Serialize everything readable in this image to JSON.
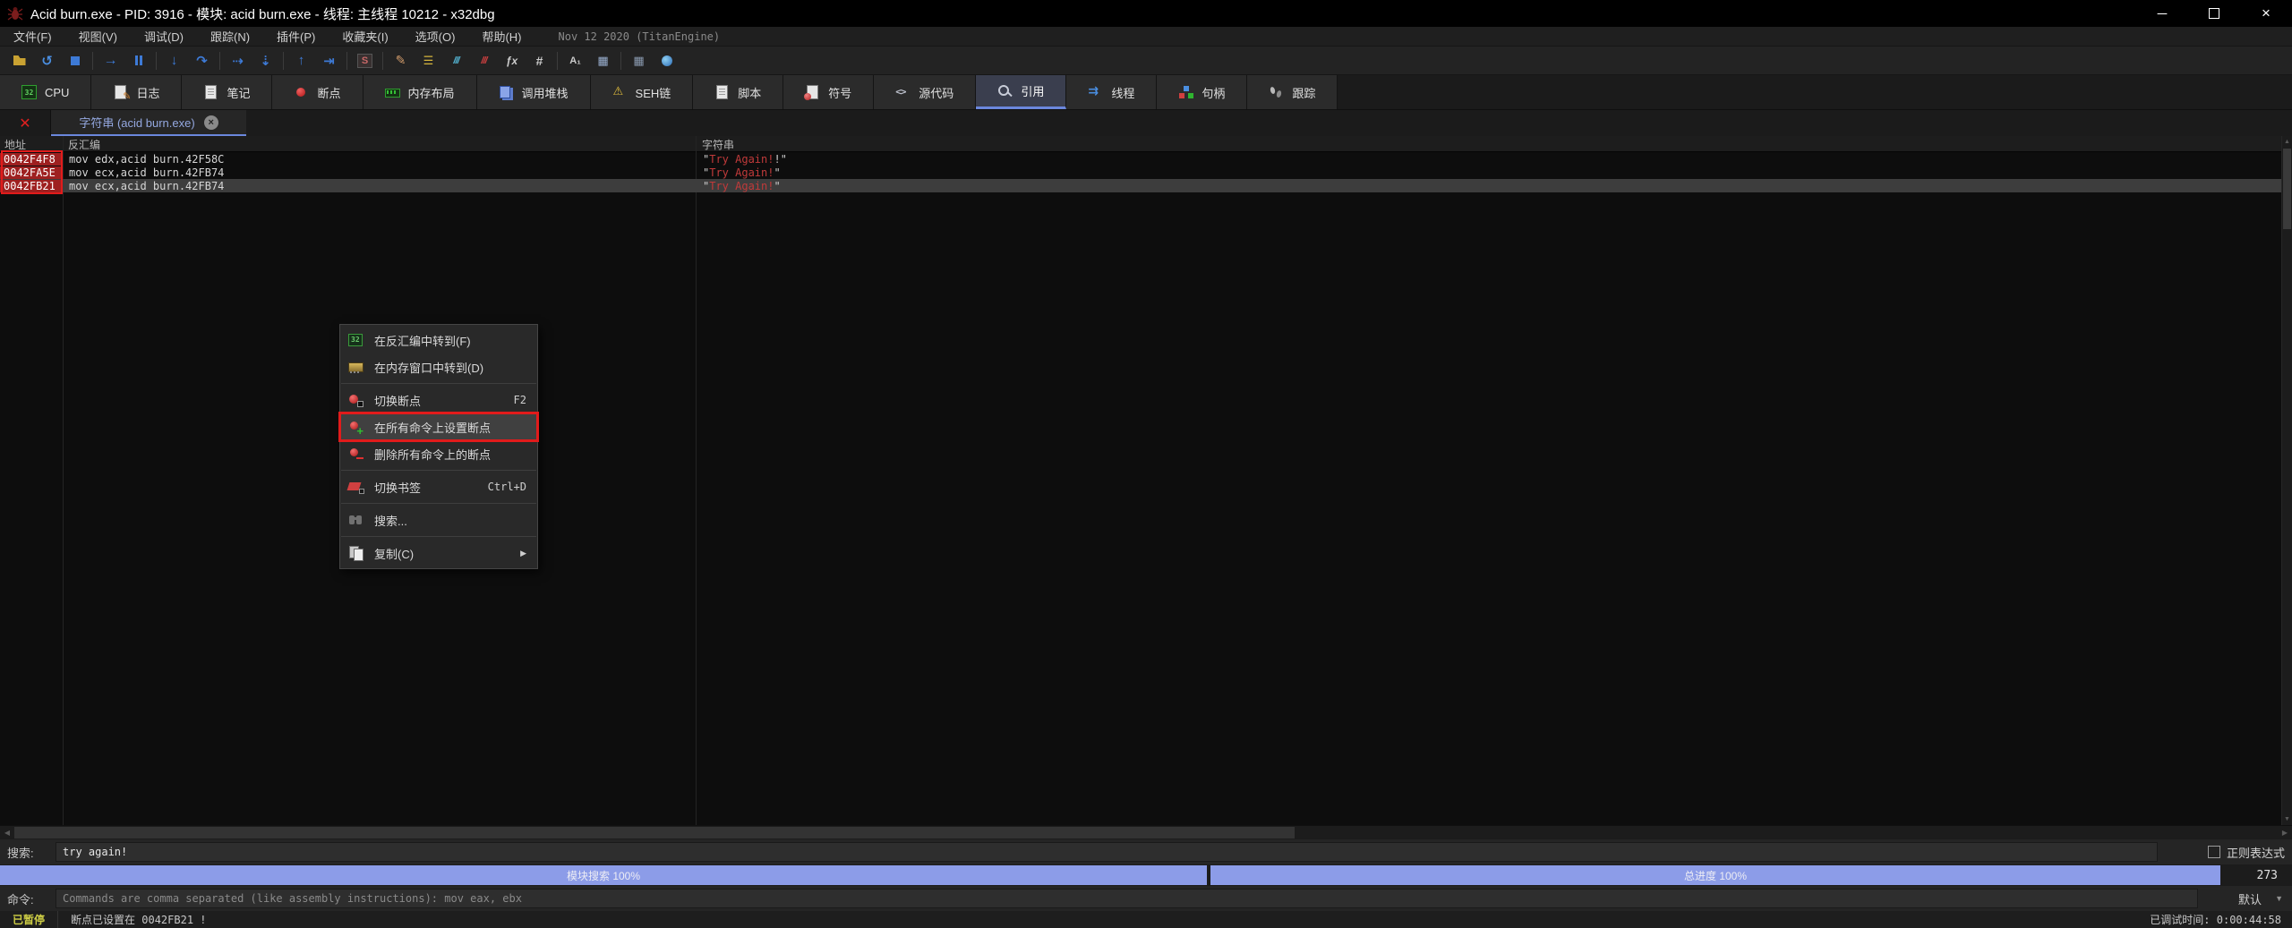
{
  "window": {
    "title": "Acid burn.exe - PID: 3916 - 模块: acid burn.exe - 线程: 主线程 10212 - x32dbg"
  },
  "menubar": {
    "items": [
      "文件(F)",
      "视图(V)",
      "调试(D)",
      "跟踪(N)",
      "插件(P)",
      "收藏夹(I)",
      "选项(O)",
      "帮助(H)"
    ],
    "build_info": "Nov 12 2020 (TitanEngine)"
  },
  "toolbar": {
    "groups": [
      [
        "open-folder",
        "restart",
        "close-process"
      ],
      [
        "run",
        "pause"
      ],
      [
        "step-into",
        "step-over"
      ],
      [
        "run-to-cursor",
        "step-out"
      ],
      [
        "execute-till-return",
        "run-to-user-code"
      ],
      [
        "seh-chain"
      ],
      [
        "patch",
        "comments",
        "coverage-fast",
        "coverage-trace",
        "expression-fx",
        "label-hash"
      ],
      [
        "assemble-font",
        "virtual-keypad"
      ],
      [
        "calculator",
        "favourites-globe"
      ]
    ]
  },
  "tabs": [
    {
      "label": "CPU",
      "icon": "cpu",
      "active": false
    },
    {
      "label": "日志",
      "icon": "log",
      "active": false
    },
    {
      "label": "笔记",
      "icon": "notes",
      "active": false
    },
    {
      "label": "断点",
      "icon": "breakpoint",
      "active": false
    },
    {
      "label": "内存布局",
      "icon": "memory-map",
      "active": false
    },
    {
      "label": "调用堆栈",
      "icon": "call-stack",
      "active": false
    },
    {
      "label": "SEH链",
      "icon": "seh",
      "active": false
    },
    {
      "label": "脚本",
      "icon": "script",
      "active": false
    },
    {
      "label": "符号",
      "icon": "symbols",
      "active": false
    },
    {
      "label": "源代码",
      "icon": "source",
      "active": false
    },
    {
      "label": "引用",
      "icon": "references",
      "active": true
    },
    {
      "label": "线程",
      "icon": "threads",
      "active": false
    },
    {
      "label": "句柄",
      "icon": "handles",
      "active": false
    },
    {
      "label": "跟踪",
      "icon": "trace",
      "active": false
    }
  ],
  "reference_view": {
    "tab_label": "字符串 (acid burn.exe)",
    "columns": [
      "地址",
      "反汇编",
      "字符串"
    ],
    "rows": [
      {
        "address": "0042F4F8",
        "disassembly": "mov edx,acid burn.42F58C",
        "string": "Try Again!!",
        "match": "Try Again!",
        "selected": false,
        "breakpoint": true
      },
      {
        "address": "0042FA5E",
        "disassembly": "mov ecx,acid burn.42FB74",
        "string": "Try Again!",
        "match": "Try Again!",
        "selected": false,
        "breakpoint": true
      },
      {
        "address": "0042FB21",
        "disassembly": "mov ecx,acid burn.42FB74",
        "string": "Try Again!",
        "match": "Try Again!",
        "selected": true,
        "breakpoint": true
      }
    ]
  },
  "context_menu": {
    "items": [
      {
        "type": "item",
        "label": "在反汇编中转到(F)",
        "icon": "follow-disasm"
      },
      {
        "type": "item",
        "label": "在内存窗口中转到(D)",
        "icon": "follow-dump"
      },
      {
        "type": "separator"
      },
      {
        "type": "item",
        "label": "切换断点",
        "shortcut": "F2",
        "icon": "toggle-breakpoint"
      },
      {
        "type": "item",
        "label": "在所有命令上设置断点",
        "icon": "set-bp-on-all",
        "highlighted": true,
        "annotated": true
      },
      {
        "type": "item",
        "label": "删除所有命令上的断点",
        "icon": "remove-bp-on-all"
      },
      {
        "type": "separator"
      },
      {
        "type": "item",
        "label": "切换书签",
        "shortcut": "Ctrl+D",
        "icon": "bookmark"
      },
      {
        "type": "separator"
      },
      {
        "type": "item",
        "label": "搜索...",
        "icon": "search"
      },
      {
        "type": "separator"
      },
      {
        "type": "item",
        "label": "复制(C)",
        "icon": "copy",
        "submenu": true
      }
    ]
  },
  "search_bar": {
    "label": "搜索:",
    "value": "try again!",
    "regex_label": "正则表达式",
    "regex_checked": false
  },
  "progress": {
    "module_bar": {
      "label": "模块搜索 100%",
      "percent": 100
    },
    "total_bar": {
      "label": "总进度  100%",
      "percent": 100
    },
    "counter": "273"
  },
  "command_bar": {
    "label": "命令:",
    "placeholder": "Commands are comma separated (like assembly instructions): mov eax, ebx",
    "profile": "默认"
  },
  "status_bar": {
    "state": "已暂停",
    "message": "断点已设置在 0042FB21 !",
    "debug_time": "已调试时间:  0:00:44:58"
  },
  "colors": {
    "accent_blue": "#6b87dd",
    "breakpoint_red": "#9e2020",
    "annotation_red": "#e11b1b",
    "progress_blue": "#8c9ce8",
    "string_red": "#c13a3a",
    "paused_yellow": "#cfcf45"
  }
}
